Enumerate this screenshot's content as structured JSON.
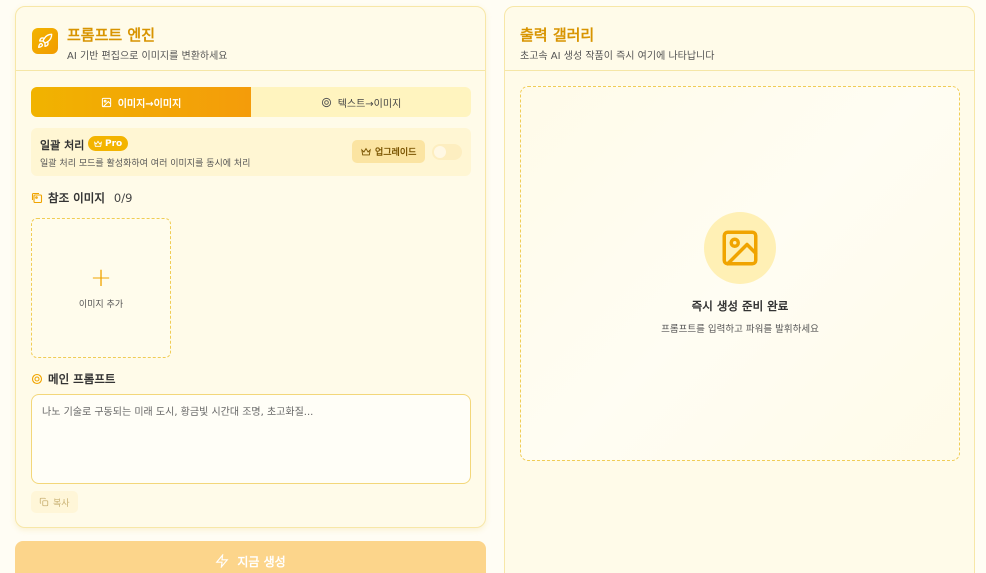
{
  "engine": {
    "title": "프롬프트 엔진",
    "subtitle": "AI 기반 편집으로 이미지를 변환하세요",
    "tabs": [
      {
        "label": "이미지→이미지",
        "active": true
      },
      {
        "label": "텍스트→이미지",
        "active": false
      }
    ],
    "batch": {
      "title": "일괄 처리",
      "badge": "Pro",
      "description": "일괄 처리 모드를 활성화하여 여러 이미지를 동시에 처리",
      "upgrade_label": "업그레이드",
      "enabled": false
    },
    "reference": {
      "label": "참조 이미지",
      "count": "0/9",
      "add_label": "이미지 추가"
    },
    "prompt": {
      "label": "메인 프롬프트",
      "placeholder": "나노 기술로 구동되는 미래 도시, 황금빛 시간대 조명, 초고화질...",
      "value": ""
    },
    "copy_label": "복사",
    "generate_label": "지금 생성"
  },
  "gallery": {
    "title": "출력 갤러리",
    "subtitle": "초고속 AI 생성 작품이 즉시 여기에 나타납니다",
    "empty_title": "즉시 생성 준비 완료",
    "empty_subtitle": "프롬프트를 입력하고 파워를 발휘하세요"
  },
  "colors": {
    "accent": "#f2b400",
    "accent_dark": "#d89400",
    "background": "#fffbe9"
  },
  "icons": [
    "rocket-icon",
    "image-icon",
    "sparkle-icon",
    "crown-icon",
    "images-icon",
    "plus-icon",
    "copy-icon",
    "bolt-icon",
    "gallery-image-icon"
  ]
}
